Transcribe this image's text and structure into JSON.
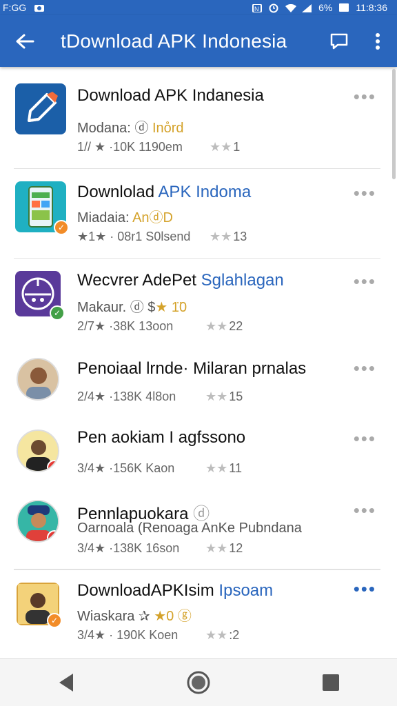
{
  "status": {
    "carrier": "F:GG",
    "battery": "6%",
    "time": "11:8:36"
  },
  "header": {
    "title": "tDownload APK Indonesia"
  },
  "items": [
    {
      "title": "Download APK Indanesia",
      "title_accent": "",
      "subtitle": "Modana: ⓓ ",
      "subtitle_accent": "Ino̊rd",
      "meta": "1// ★ ·10K 1190em",
      "rating": "1"
    },
    {
      "title": "Downlolad ",
      "title_accent": "APK Indoma",
      "subtitle": "Miadaia: ",
      "subtitle_accent": "AnⓓD",
      "meta": "★1★ · 08r1 S0lsend",
      "rating": "13"
    },
    {
      "title": "Wecvrer AdePet ",
      "title_accent": "Sglahlagan",
      "subtitle": "Makaur. ⓓ $",
      "subtitle_accent": "★ 1̈0",
      "meta": "2/7★ ·38K 13oon",
      "rating": "22"
    },
    {
      "title": "Penoiaal lrnde· Milaran prnalas",
      "title_accent": "",
      "subtitle": "",
      "subtitle_accent": "",
      "meta": "2/4★ ·138K 4l8on",
      "rating": "15"
    },
    {
      "title": "Pen aokiam I agfssono",
      "title_accent": "",
      "subtitle": "",
      "subtitle_accent": "",
      "meta": "3/4★ ·156K Kaon",
      "rating": "11"
    },
    {
      "title": "Pennlapuokara ",
      "title_accent": "",
      "subtitle": "Oarnoala (Renoaga AnKe Pubndana",
      "subtitle_accent": "",
      "meta": "3/4★ ·138K 16son",
      "rating": "12"
    },
    {
      "title": "DownloadAPKIsim ",
      "title_accent": "Ipsoam",
      "subtitle": "Wiaskara ✰ ",
      "subtitle_accent": "★0 ⓖ",
      "meta": "3/4★ · 190K Koen",
      "rating": ":2"
    }
  ],
  "colors": {
    "brand": "#2a66bd",
    "badge_orange": "#f28c28",
    "badge_green": "#43a047",
    "badge_red": "#e53935"
  }
}
